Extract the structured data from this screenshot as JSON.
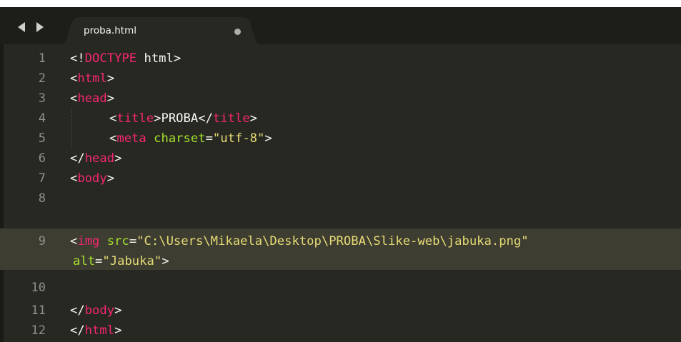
{
  "tabbar": {
    "nav": {
      "back_icon": "triangle-left-icon",
      "forward_icon": "triangle-right-icon"
    },
    "tab": {
      "title": "proba.html",
      "dirty_icon": "unsaved-dot-icon"
    }
  },
  "editor": {
    "active_line": "9",
    "lines": {
      "l1": {
        "num": "1",
        "lt": "<!",
        "tag": "DOCTYPE",
        "rest": " html>"
      },
      "l2": {
        "num": "2",
        "lt": "<",
        "tag": "html",
        "gt": ">"
      },
      "l3": {
        "num": "3",
        "lt": "<",
        "tag": "head",
        "gt": ">"
      },
      "l4": {
        "num": "4",
        "lt1": "<",
        "tag1": "title",
        "gt1": ">",
        "text": "PROBA",
        "lt2": "</",
        "tag2": "title",
        "gt2": ">"
      },
      "l5": {
        "num": "5",
        "lt": "<",
        "tag": "meta",
        "sp": " ",
        "attr": "charset",
        "eq": "=",
        "val": "\"utf-8\"",
        "gt": ">"
      },
      "l6": {
        "num": "6",
        "lt": "</",
        "tag": "head",
        "gt": ">"
      },
      "l7": {
        "num": "7",
        "lt": "<",
        "tag": "body",
        "gt": ">"
      },
      "l8": {
        "num": "8"
      },
      "l9": {
        "num": "9",
        "lt": "<",
        "tag": "img",
        "sp": " ",
        "attr": "src",
        "eq": "=",
        "val": "\"C:\\Users\\Mikaela\\Desktop\\PROBA\\Slike-web\\jabuka.png\""
      },
      "l9b": {
        "attr": "alt",
        "eq": "=",
        "val": "\"Jabuka\"",
        "gt": ">"
      },
      "l10": {
        "num": "10"
      },
      "l11": {
        "num": "11",
        "lt": "</",
        "tag": "body",
        "gt": ">"
      },
      "l12": {
        "num": "12",
        "lt": "</",
        "tag": "html",
        "gt": ">"
      }
    }
  },
  "colors": {
    "background": "#272822",
    "active_line": "#3e3d32",
    "tag": "#f92672",
    "attribute": "#a6e22e",
    "string": "#e6db74",
    "text": "#f8f8f2",
    "gutter": "#90908a"
  }
}
